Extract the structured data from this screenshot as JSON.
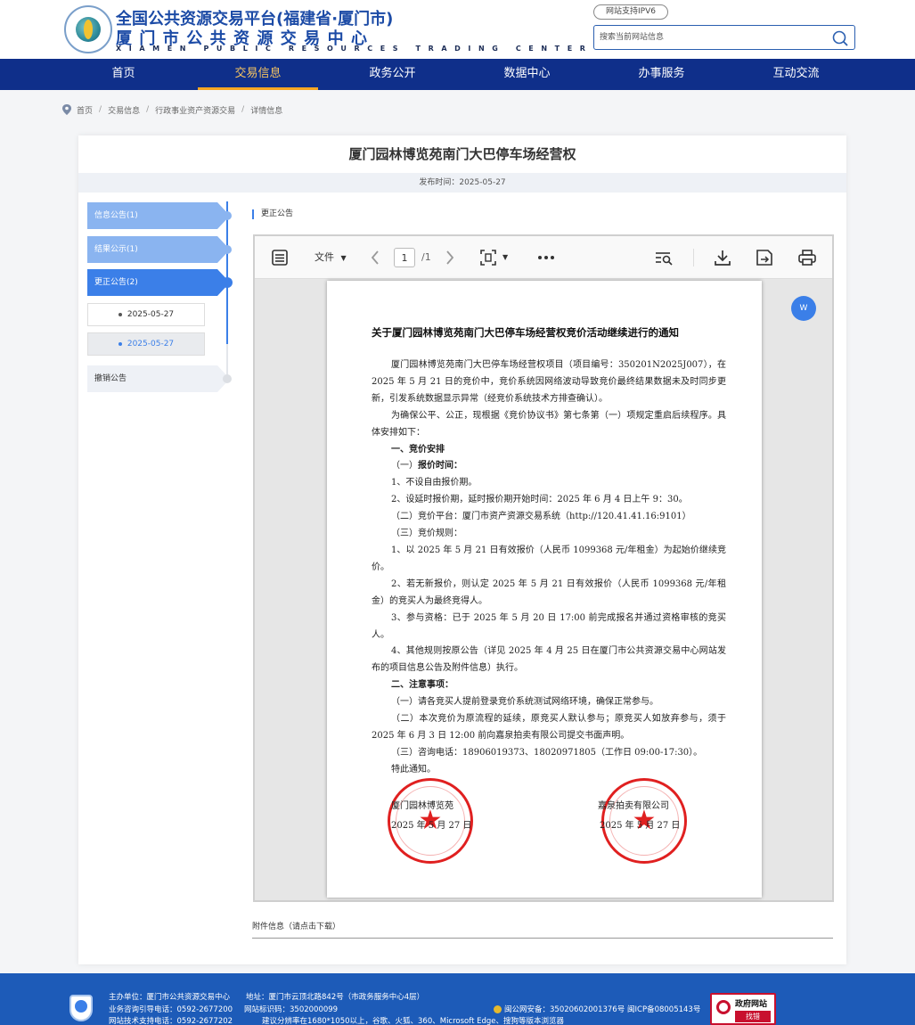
{
  "header": {
    "title_cn": "全国公共资源交易平台(福建省·厦门市)",
    "subtitle_cn": "厦门市公共资源交易中心",
    "subtitle_en": "XIAMEN PUBLIC RESOURCES TRADING CENTER",
    "ipv6_badge": "网站支持IPV6",
    "search_placeholder": "搜索当前网站信息"
  },
  "nav": {
    "items": [
      "首页",
      "交易信息",
      "政务公开",
      "数据中心",
      "办事服务",
      "互动交流"
    ],
    "active_index": 1
  },
  "breadcrumb": {
    "items": [
      "首页",
      "交易信息",
      "行政事业资产资源交易",
      "详情信息"
    ]
  },
  "page": {
    "title": "厦门园林博览苑南门大巴停车场经营权",
    "publish_time": "发布时间：2025-05-27"
  },
  "sidebar": {
    "items": [
      {
        "label": "信息公告(1)",
        "state": "done"
      },
      {
        "label": "结果公示(1)",
        "state": "done"
      },
      {
        "label": "更正公告(2)",
        "state": "active"
      },
      {
        "label": "撤销公告",
        "state": "pending"
      }
    ],
    "sub_dates": [
      "2025-05-27",
      "2025-05-27"
    ],
    "selected_sub_index": 1
  },
  "section_label": "更正公告",
  "pdf_toolbar": {
    "file_menu": "文件",
    "page_current": "1",
    "page_total": "/1"
  },
  "document": {
    "title": "关于厦门园林博览苑南门大巴停车场经营权竞价活动继续进行的通知",
    "para1": "厦门园林博览苑南门大巴停车场经营权项目（项目编号：350201N2025J007），在 2025 年 5 月 21 日的竞价中，竞价系统因网络波动导致竞价最终结果数据未及时同步更新，引发系统数据显示异常（经竞价系统技术方排查确认）。",
    "para2": "为确保公平、公正，现根据《竞价协议书》第七条第（一）项规定重启后续程序。具体安排如下：",
    "h1": "一、竞价安排",
    "s1_prefix": "（一）",
    "s1_bold": "报价时间：",
    "l1": "1、不设自由报价期。",
    "l2": "2、设延时报价期，延时报价期开始时间：2025 年 6 月 4 日上午 9：30。",
    "s2": "（二）竞价平台：厦门市资产资源交易系统（http://120.41.41.16:9101）",
    "s3": "（三）竞价规则：",
    "r1": "1、以 2025 年 5 月 21 日有效报价（人民币 1099368 元/年租金）为起始价继续竞价。",
    "r2": "2、若无新报价，则认定 2025 年 5 月 21 日有效报价（人民币 1099368 元/年租金）的竞买人为最终竞得人。",
    "r3": "3、参与资格：已于 2025 年 5 月 20 日 17:00 前完成报名并通过资格审核的竞买人。",
    "r4": "4、其他规则按原公告（详见 2025 年 4 月 25 日在厦门市公共资源交易中心网站发布的项目信息公告及附件信息）执行。",
    "h2": "二、注意事项：",
    "n1": "（一）请各竞买人提前登录竞价系统测试网络环境，确保正常参与。",
    "n2": "（二）本次竞价为原流程的延续，原竞买人默认参与；原竞买人如放弃参与，须于 2025 年 6 月 3 日 12:00 前向嘉泉拍卖有限公司提交书面声明。",
    "n3": "（三）咨询电话：18906019373、18020971805（工作日 09:00-17:30）。",
    "closing": "特此通知。",
    "sig_left": "厦门园林博览苑",
    "sig_right": "嘉泉拍卖有限公司",
    "date_left": "2025 年 5 月 27 日",
    "date_right": "2025 年 5 月 27 日"
  },
  "attachment_label": "附件信息（请点击下载）",
  "footer": {
    "sponsor": "主办单位：厦门市公共资源交易中心",
    "address": "地址：厦门市云顶北路842号（市政务服务中心4层）",
    "hotline": "业务咨询引导电话：0592-2677200",
    "site_id": "网站标识码：3502000099",
    "tech": "网站技术支持电话：0592-2677202",
    "browser": "建议分辨率在1680*1050以上，谷歌、火狐、360、Microsoft Edge、搜狗等版本浏览器",
    "police": "闽公网安备：35020602001376号",
    "icp": "闽ICP备08005143号",
    "gov_badge_1": "政府网站",
    "gov_badge_2": "找错"
  }
}
